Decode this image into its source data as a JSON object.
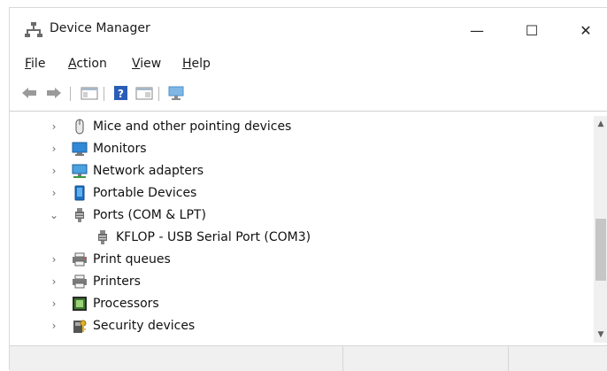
{
  "window": {
    "title": "Device Manager",
    "controls": {
      "minimize": "—",
      "maximize": "☐",
      "close": "✕"
    }
  },
  "menu": [
    {
      "accel": "F",
      "rest": "ile"
    },
    {
      "accel": "A",
      "rest": "ction"
    },
    {
      "accel": "V",
      "rest": "iew"
    },
    {
      "accel": "H",
      "rest": "elp"
    }
  ],
  "toolbar": {
    "icons": [
      "back-arrow-icon",
      "forward-arrow-icon",
      "show-hide-console-tree-icon",
      "help-icon",
      "properties-icon",
      "display-device-icon"
    ]
  },
  "tree": {
    "items": [
      {
        "label": "Mice and other pointing devices",
        "icon": "mouse-icon",
        "state": "collapsed",
        "level": 0
      },
      {
        "label": "Monitors",
        "icon": "monitor-icon",
        "state": "collapsed",
        "level": 0
      },
      {
        "label": "Network adapters",
        "icon": "network-adapter-icon",
        "state": "collapsed",
        "level": 0
      },
      {
        "label": "Portable Devices",
        "icon": "portable-device-icon",
        "state": "collapsed",
        "level": 0
      },
      {
        "label": "Ports (COM & LPT)",
        "icon": "port-icon",
        "state": "expanded",
        "level": 0
      },
      {
        "label": "KFLOP - USB Serial Port (COM3)",
        "icon": "port-icon",
        "state": "leaf",
        "level": 1
      },
      {
        "label": "Print queues",
        "icon": "print-queue-icon",
        "state": "collapsed",
        "level": 0
      },
      {
        "label": "Printers",
        "icon": "printer-icon",
        "state": "collapsed",
        "level": 0
      },
      {
        "label": "Processors",
        "icon": "processor-icon",
        "state": "collapsed",
        "level": 0
      },
      {
        "label": "Security devices",
        "icon": "security-device-icon",
        "state": "collapsed",
        "level": 0
      }
    ]
  },
  "chevrons": {
    "collapsed": "›",
    "expanded": "⌄"
  },
  "colors": {
    "accent": "#1e8fd6",
    "monitor_blue": "#2e8ad8",
    "processor_green": "#3a7a2a"
  }
}
